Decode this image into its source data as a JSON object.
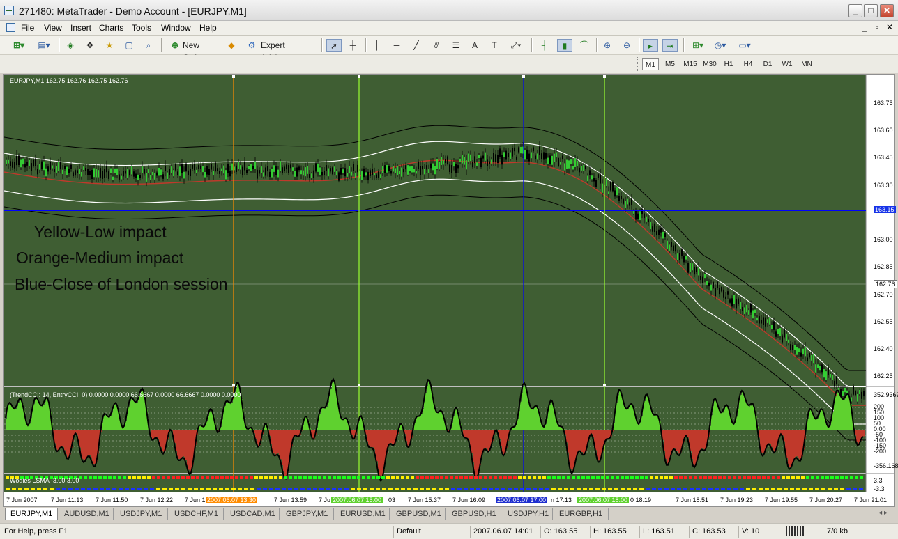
{
  "window": {
    "title": "271480: MetaTrader - Demo Account - [EURJPY,M1]",
    "buttons": {
      "minimize": "_",
      "maximize": "□",
      "close": "✕"
    }
  },
  "menu": {
    "items": [
      "File",
      "View",
      "Insert",
      "Charts",
      "Tools",
      "Window",
      "Help"
    ],
    "mdi_controls": [
      "_",
      "▫",
      "✕"
    ]
  },
  "toolbar": {
    "new_order": "New Order",
    "expert_advisors": "Expert Advisors"
  },
  "periods": [
    "M1",
    "M5",
    "M15",
    "M30",
    "H1",
    "H4",
    "D1",
    "W1",
    "MN"
  ],
  "active_period": "M1",
  "chart": {
    "legend": "EURJPY,M1  162.75 162.76 162.75 162.76",
    "price_labels": [
      "163.75",
      "163.60",
      "163.45",
      "163.30",
      "163.15",
      "163.00",
      "162.85",
      "162.76",
      "162.70",
      "162.55",
      "162.40",
      "162.25"
    ],
    "horizontal_line_price": "163.15",
    "current_price": "162.76",
    "annotations": [
      "Yellow-Low impact",
      "Orange-Medium impact",
      "Blue-Close of London session"
    ],
    "colors": {
      "background": "#3f5e33",
      "bull_candle": "#33cc33",
      "bear_candle": "#000000",
      "ma_middle": "#c0392b",
      "band_inner": "#ffffff",
      "band_outer": "#000000",
      "orange_line": "#ff8c00",
      "yellow_line": "#99ff33",
      "blue_line": "#0000ff"
    }
  },
  "indicator_cci": {
    "legend": "(TrendCCI: 14, EntryCCI: 0)  0.0000 0.0000 66.6667 0.0000 66.6667 0.0000 0.0000",
    "scale_labels": [
      "352.9369",
      "200",
      "150",
      "100",
      "50",
      "0.00",
      "-50",
      "-100",
      "-150",
      "-200",
      "-356.168"
    ]
  },
  "indicator_lsma": {
    "legend": "Wodies LSMA -3.00 3.00",
    "scale_labels": [
      "3.3",
      "-3.3"
    ]
  },
  "time_axis": {
    "labels": [
      "7 Jun 2007",
      "7 Jun 11:13",
      "7 Jun 11:50",
      "7 Jun 12:22",
      "7 Jun 1",
      "7 Jun 13:59",
      "7 Ju",
      "03",
      "7 Jun 15:37",
      "7 Jun 16:09",
      "n 17:13",
      "0 18:19",
      "7 Jun 18:51",
      "7 Jun 19:23",
      "7 Jun 19:55",
      "7 Jun 20:27",
      "7 Jun 21:01"
    ],
    "highlights": [
      {
        "label": "2007.06.07 13:30",
        "color": "#ff8c00"
      },
      {
        "label": "2007.06.07 15:00",
        "color": "#5fd12f"
      },
      {
        "label": "2007.06.07 17:00",
        "color": "#1f2fcf"
      },
      {
        "label": "2007.06.07 18:00",
        "color": "#5fd12f"
      }
    ]
  },
  "tabs": [
    "EURJPY,M1",
    "AUDUSD,M1",
    "USDJPY,M1",
    "USDCHF,M1",
    "USDCAD,M1",
    "GBPJPY,M1",
    "EURUSD,M1",
    "GBPUSD,M1",
    "GBPUSD,H1",
    "USDJPY,H1",
    "EURGBP,H1"
  ],
  "active_tab": "EURJPY,M1",
  "status": {
    "help": "For Help, press F1",
    "profile": "Default",
    "time": "2007.06.07 14:01",
    "open": "O: 163.55",
    "high": "H: 163.55",
    "low": "L: 163.51",
    "close": "C: 163.53",
    "volume": "V: 10",
    "traffic": "7/0 kb"
  }
}
